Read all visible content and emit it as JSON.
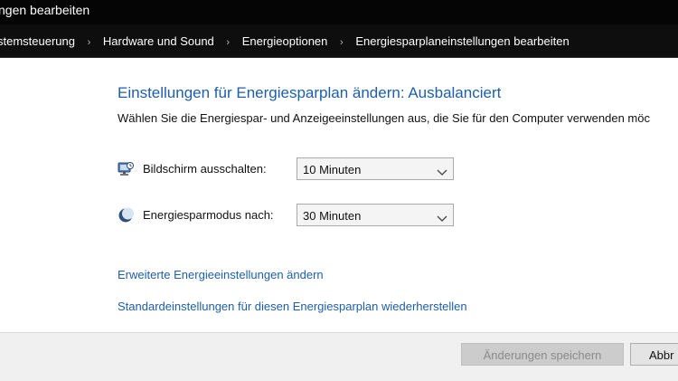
{
  "window": {
    "title": "ngen bearbeiten"
  },
  "breadcrumb": {
    "items": [
      "stemsteuerung",
      "Hardware und Sound",
      "Energieoptionen",
      "Energiesparplaneinstellungen bearbeiten"
    ],
    "separator": "›"
  },
  "main": {
    "heading": "Einstellungen für Energiesparplan ändern: Ausbalanciert",
    "description": "Wählen Sie die Energiespar- und Anzeigeeinstellungen aus, die Sie für den Computer verwenden möc",
    "settings": [
      {
        "label": "Bildschirm ausschalten:",
        "value": "10 Minuten",
        "icon": "monitor-icon"
      },
      {
        "label": "Energiesparmodus nach:",
        "value": "30 Minuten",
        "icon": "sleep-moon-icon"
      }
    ],
    "links": {
      "advanced": "Erweiterte Energieeinstellungen ändern",
      "restore": "Standardeinstellungen für diesen Energiesparplan wiederherstellen"
    }
  },
  "footer": {
    "save_label": "Änderungen speichern",
    "cancel_label": "Abbr"
  },
  "colors": {
    "accent": "#1e5fa8",
    "titlebar": "#050505",
    "footer": "#f0f0f0"
  }
}
